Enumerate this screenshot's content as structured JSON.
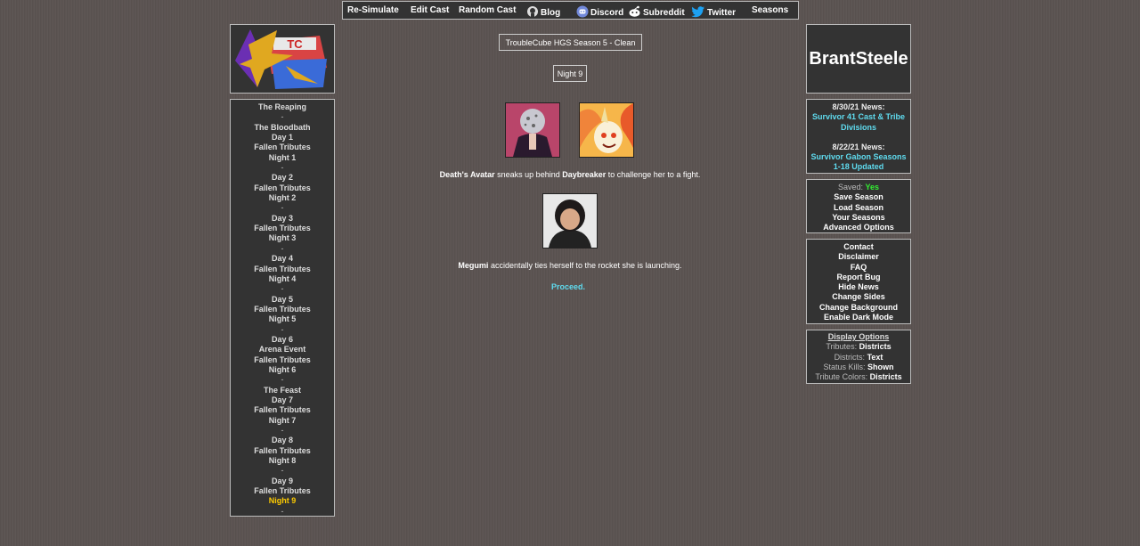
{
  "nav": {
    "resimulate": "Re-Simulate",
    "edit_cast": "Edit Cast",
    "random_cast": "Random Cast",
    "blog": "Blog",
    "discord": "Discord",
    "subreddit": "Subreddit",
    "twitter": "Twitter",
    "seasons": "Seasons"
  },
  "logo": {
    "text": "TC"
  },
  "brand": "BrantSteele",
  "menu": [
    {
      "label": "The Reaping"
    },
    {
      "label": "-"
    },
    {
      "label": "The Bloodbath"
    },
    {
      "label": "Day 1"
    },
    {
      "label": "Fallen Tributes"
    },
    {
      "label": "Night 1"
    },
    {
      "label": "-"
    },
    {
      "label": "Day 2"
    },
    {
      "label": "Fallen Tributes"
    },
    {
      "label": "Night 2"
    },
    {
      "label": "-"
    },
    {
      "label": "Day 3"
    },
    {
      "label": "Fallen Tributes"
    },
    {
      "label": "Night 3"
    },
    {
      "label": "-"
    },
    {
      "label": "Day 4"
    },
    {
      "label": "Fallen Tributes"
    },
    {
      "label": "Night 4"
    },
    {
      "label": "-"
    },
    {
      "label": "Day 5"
    },
    {
      "label": "Fallen Tributes"
    },
    {
      "label": "Night 5"
    },
    {
      "label": "-"
    },
    {
      "label": "Day 6"
    },
    {
      "label": "Arena Event"
    },
    {
      "label": "Fallen Tributes"
    },
    {
      "label": "Night 6"
    },
    {
      "label": "-"
    },
    {
      "label": "The Feast"
    },
    {
      "label": "Day 7"
    },
    {
      "label": "Fallen Tributes"
    },
    {
      "label": "Night 7"
    },
    {
      "label": "-"
    },
    {
      "label": "Day 8"
    },
    {
      "label": "Fallen Tributes"
    },
    {
      "label": "Night 8"
    },
    {
      "label": "-"
    },
    {
      "label": "Day 9"
    },
    {
      "label": "Fallen Tributes"
    },
    {
      "label": "Night 9",
      "current": true
    },
    {
      "label": "-"
    }
  ],
  "main": {
    "season_title": "TroubleCube HGS Season 5 - Clean",
    "phase_title": "Night 9",
    "events": [
      {
        "actor": "Death's Avatar",
        "text1": " sneaks up behind ",
        "target": "Daybreaker",
        "text2": " to challenge her to a fight."
      },
      {
        "actor": "Megumi",
        "text1": " accidentally ties herself to the rocket she is launching.",
        "target": "",
        "text2": ""
      }
    ],
    "proceed": "Proceed."
  },
  "news": [
    {
      "date": "8/30/21 News:",
      "link": "Survivor 41 Cast & Tribe Divisions"
    },
    {
      "date": "8/22/21 News:",
      "link": "Survivor Gabon Seasons 1-18 Updated"
    }
  ],
  "save": {
    "saved_label": "Saved:",
    "saved_value": "Yes",
    "save": "Save Season",
    "load": "Load Season",
    "yours": "Your Seasons",
    "advanced": "Advanced Options"
  },
  "links": [
    "Contact",
    "Disclaimer",
    "FAQ",
    "Report Bug",
    "Hide News",
    "Change Sides",
    "Change Background",
    "Enable Dark Mode"
  ],
  "display": {
    "heading": "Display Options",
    "rows": [
      {
        "label": "Tributes:",
        "value": "Districts"
      },
      {
        "label": "Districts:",
        "value": "Text"
      },
      {
        "label": "Status Kills:",
        "value": "Shown"
      },
      {
        "label": "Tribute Colors:",
        "value": "Districts"
      }
    ]
  },
  "colors": {
    "accent_cyan": "#5fdcf0",
    "current_yellow": "#ffcc00",
    "saved_green": "#33ee33",
    "panel": "#333333"
  }
}
